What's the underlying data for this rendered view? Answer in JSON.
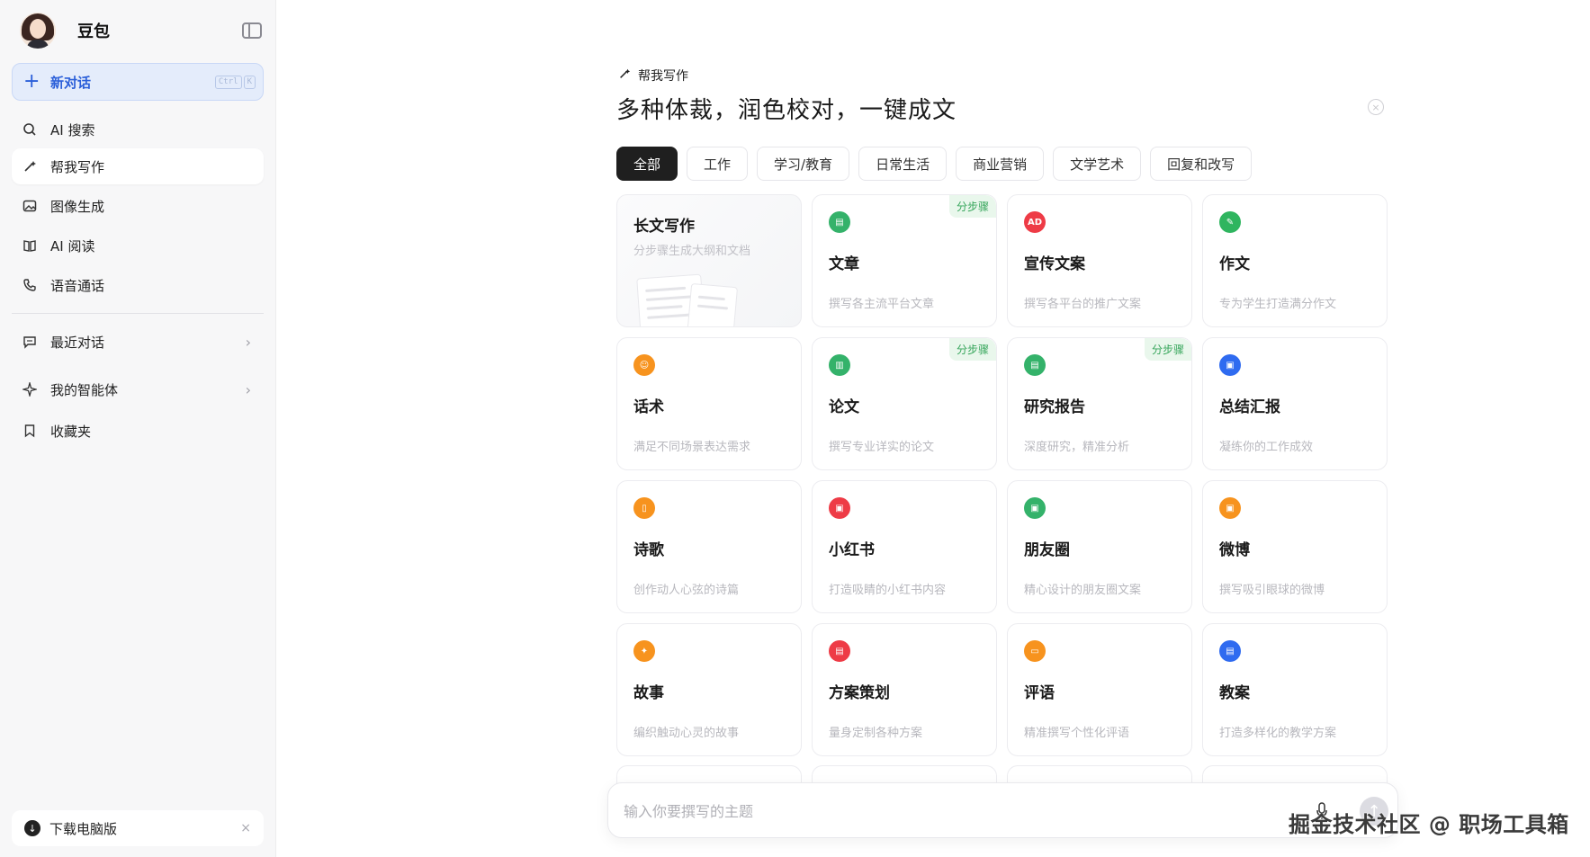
{
  "sidebar": {
    "app_name": "豆包",
    "new_chat": {
      "label": "新对话",
      "shortcut": [
        "Ctrl",
        "K"
      ]
    },
    "nav": [
      {
        "label": "AI 搜索",
        "icon": "search-icon"
      },
      {
        "label": "帮我写作",
        "icon": "pen-sparkle-icon",
        "active": true
      },
      {
        "label": "图像生成",
        "icon": "image-icon"
      },
      {
        "label": "AI 阅读",
        "icon": "book-icon"
      },
      {
        "label": "语音通话",
        "icon": "phone-icon"
      }
    ],
    "sections": [
      {
        "label": "最近对话",
        "icon": "chat-icon"
      },
      {
        "label": "我的智能体",
        "icon": "sparkle-icon"
      },
      {
        "label": "收藏夹",
        "icon": "bookmark-icon"
      }
    ],
    "download": {
      "label": "下载电脑版",
      "close": "×"
    }
  },
  "main": {
    "section_label": "帮我写作",
    "title": "多种体裁，润色校对，一键成文",
    "tabs": [
      "全部",
      "工作",
      "学习/教育",
      "日常生活",
      "商业营销",
      "文学艺术",
      "回复和改写"
    ],
    "badge_text": "分步骤",
    "cards": [
      {
        "title": "长文写作",
        "desc": "分步骤生成大纲和文档",
        "color": "",
        "glyph": ""
      },
      {
        "title": "文章",
        "desc": "撰写各主流平台文章",
        "color": "#34b26a",
        "glyph": "▤",
        "badge": true
      },
      {
        "title": "宣传文案",
        "desc": "撰写各平台的推广文案",
        "color": "#ee3b46",
        "glyph": "AD"
      },
      {
        "title": "作文",
        "desc": "专为学生打造满分作文",
        "color": "#2fb55f",
        "glyph": "✎"
      },
      {
        "title": "话术",
        "desc": "满足不同场景表达需求",
        "color": "#f7931e",
        "glyph": "☺"
      },
      {
        "title": "论文",
        "desc": "撰写专业详实的论文",
        "color": "#34b26a",
        "glyph": "▥",
        "badge": true
      },
      {
        "title": "研究报告",
        "desc": "深度研究，精准分析",
        "color": "#34b26a",
        "glyph": "▤",
        "badge": true
      },
      {
        "title": "总结汇报",
        "desc": "凝练你的工作成效",
        "color": "#2f6bf0",
        "glyph": "▣"
      },
      {
        "title": "诗歌",
        "desc": "创作动人心弦的诗篇",
        "color": "#f7931e",
        "glyph": "▯"
      },
      {
        "title": "小红书",
        "desc": "打造吸睛的小红书内容",
        "color": "#ee3b46",
        "glyph": "▣"
      },
      {
        "title": "朋友圈",
        "desc": "精心设计的朋友圈文案",
        "color": "#34b26a",
        "glyph": "▣"
      },
      {
        "title": "微博",
        "desc": "撰写吸引眼球的微博",
        "color": "#f7931e",
        "glyph": "▣"
      },
      {
        "title": "故事",
        "desc": "编织触动心灵的故事",
        "color": "#f7931e",
        "glyph": "✦"
      },
      {
        "title": "方案策划",
        "desc": "量身定制各种方案",
        "color": "#ee3b46",
        "glyph": "▤"
      },
      {
        "title": "评语",
        "desc": "精准撰写个性化评语",
        "color": "#f7931e",
        "glyph": "▭"
      },
      {
        "title": "教案",
        "desc": "打造多样化的教学方案",
        "color": "#2f6bf0",
        "glyph": "▤"
      }
    ],
    "peek_colors": [
      "#f7931e",
      "#2f6bf0",
      "#f7931e",
      "#ee3b46"
    ],
    "composer": {
      "placeholder": "输入你要撰写的主题"
    }
  },
  "watermark": "掘金技术社区 @ 职场工具箱"
}
